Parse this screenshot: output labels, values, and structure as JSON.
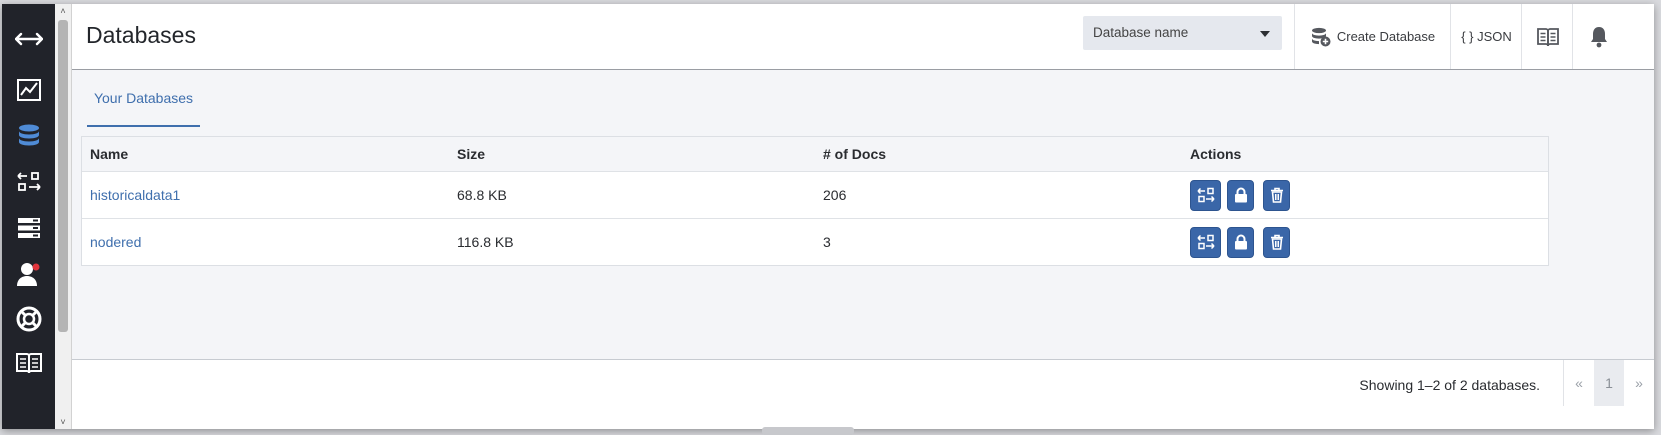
{
  "header": {
    "title": "Databases",
    "db_select_placeholder": "Database name",
    "create_label": "Create Database",
    "json_label": "{ } JSON"
  },
  "tabs": [
    {
      "label": "Your Databases",
      "active": true
    }
  ],
  "table": {
    "columns": [
      "Name",
      "Size",
      "# of Docs",
      "Actions"
    ],
    "rows": [
      {
        "name": "historicaldata1",
        "size": "68.8 KB",
        "docs": "206"
      },
      {
        "name": "nodered",
        "size": "116.8 KB",
        "docs": "3"
      }
    ],
    "action_icons": [
      "replicate-icon",
      "lock-icon",
      "trash-icon"
    ]
  },
  "footer": {
    "showing": "Showing 1–2 of 2 databases.",
    "pager": {
      "prev": "«",
      "current": "1",
      "next": "»"
    }
  },
  "sidebar": {
    "items": [
      "collapse-toggle-icon",
      "monitoring-icon",
      "databases-icon",
      "replication-icon",
      "account-icon",
      "user-icon",
      "support-icon",
      "documentation-icon"
    ],
    "active_item": "databases-icon",
    "accent": "#3f6fad"
  },
  "scrollbar": {
    "up": "˄",
    "down": "˅"
  }
}
